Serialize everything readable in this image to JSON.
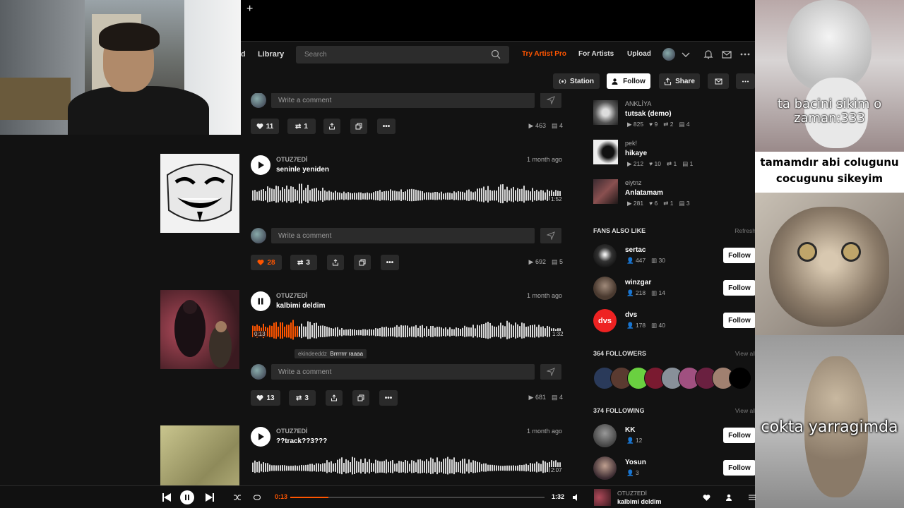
{
  "topbar": {
    "new_tab": "+"
  },
  "nav": {
    "cut_label": "d",
    "library": "Library",
    "search_placeholder": "Search",
    "try_pro": "Try Artist Pro",
    "for_artists": "For Artists",
    "upload": "Upload"
  },
  "actions": {
    "station": "Station",
    "follow": "Follow",
    "share": "Share"
  },
  "feed": {
    "comment_placeholder": "Write a comment",
    "top_item": {
      "likes": "11",
      "reposts": "1",
      "plays": "463",
      "comments": "4"
    },
    "tracks": [
      {
        "user": "OTUZ7EDİ",
        "title": "seninle yeniden",
        "date": "1 month ago",
        "duration": "1:52",
        "likes": "28",
        "reposts": "3",
        "plays": "692",
        "comments": "5",
        "liked": true,
        "progress": 0
      },
      {
        "user": "OTUZ7EDİ",
        "title": "kalbimi deldim",
        "date": "1 month ago",
        "elapsed": "0:13",
        "duration": "1:32",
        "likes": "13",
        "reposts": "3",
        "plays": "681",
        "comments": "4",
        "liked": false,
        "progress": 0.15,
        "timed_comment": {
          "user": "ekindeeddz",
          "text": "Brrrrrrr raaaa"
        }
      },
      {
        "user": "OTUZ7EDİ",
        "title": "??track??3???",
        "date": "1 month ago",
        "duration": "2:07",
        "progress": 0
      }
    ]
  },
  "sidebar": {
    "related": [
      {
        "user": "ANKLİYA",
        "title": "tutsak (demo)",
        "plays": "825",
        "likes": "9",
        "reposts": "2",
        "comments": "4"
      },
      {
        "user": "pek!",
        "title": "hikaye",
        "plays": "212",
        "likes": "10",
        "reposts": "1",
        "comments": "1"
      },
      {
        "user": "eiytnz",
        "title": "Anlatamam",
        "plays": "281",
        "likes": "6",
        "reposts": "1",
        "comments": "3"
      }
    ],
    "fans_title": "FANS ALSO LIKE",
    "refresh": "Refresh",
    "fans": [
      {
        "name": "sertac",
        "followers": "447",
        "tracks": "30",
        "follow": "Follow"
      },
      {
        "name": "winzgar",
        "followers": "218",
        "tracks": "14",
        "follow": "Follow"
      },
      {
        "name": "dvs",
        "followers": "178",
        "tracks": "40",
        "follow": "Follow",
        "avatar_text": "dvs"
      }
    ],
    "followers_title": "364 FOLLOWERS",
    "following_title": "374 FOLLOWING",
    "view_all": "View all",
    "following": [
      {
        "name": "KK",
        "followers": "12",
        "follow": "Follow"
      },
      {
        "name": "Yosun",
        "followers": "3",
        "follow": "Follow"
      }
    ]
  },
  "memes": [
    {
      "caption": "ta bacini sikim o zaman:333"
    },
    {
      "caption": "tamamdır abi colugunu cocugunu sikeyim"
    },
    {
      "caption": "cokta yarragimda"
    }
  ],
  "player": {
    "elapsed": "0:13",
    "duration": "1:32",
    "progress": 0.15,
    "user": "OTUZ7EDİ",
    "title": "kalbimi deldim"
  },
  "colors": {
    "accent": "#ff5500",
    "bg": "#121212",
    "panel": "#2a2a2a"
  }
}
